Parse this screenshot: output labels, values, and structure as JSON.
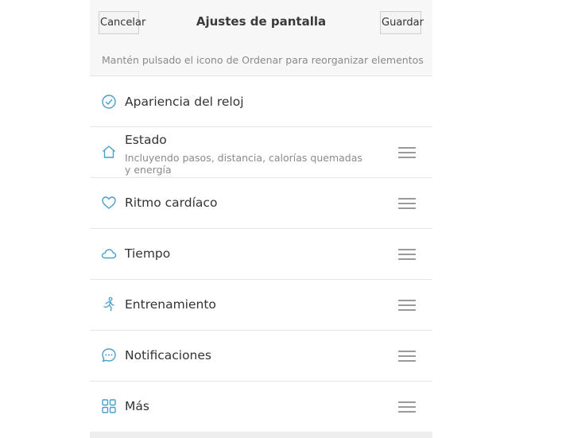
{
  "header": {
    "cancel_label": "Cancelar",
    "title": "Ajustes de pantalla",
    "save_label": "Guardar"
  },
  "hint": "Mantén pulsado el icono de Ordenar para reorganizar elementos",
  "items": [
    {
      "label": "Apariencia del reloj",
      "icon": "clock-icon",
      "reorderable": false
    },
    {
      "label": "Estado",
      "sublabel": "Incluyendo pasos, distancia, calorías quemadas y energía",
      "icon": "home-icon",
      "reorderable": true
    },
    {
      "label": "Ritmo cardíaco",
      "icon": "heart-icon",
      "reorderable": true
    },
    {
      "label": "Tiempo",
      "icon": "cloud-icon",
      "reorderable": true
    },
    {
      "label": "Entrenamiento",
      "icon": "running-icon",
      "reorderable": true
    },
    {
      "label": "Notificaciones",
      "icon": "chat-bubble-icon",
      "reorderable": true
    },
    {
      "label": "Más",
      "icon": "grid-icon",
      "reorderable": true
    }
  ],
  "colors": {
    "accent_icon": "#4a9ec9",
    "text": "#333333",
    "subtext": "#8a8a8a",
    "header_bg": "#f7f7f7",
    "divider": "#e6e6e6"
  }
}
